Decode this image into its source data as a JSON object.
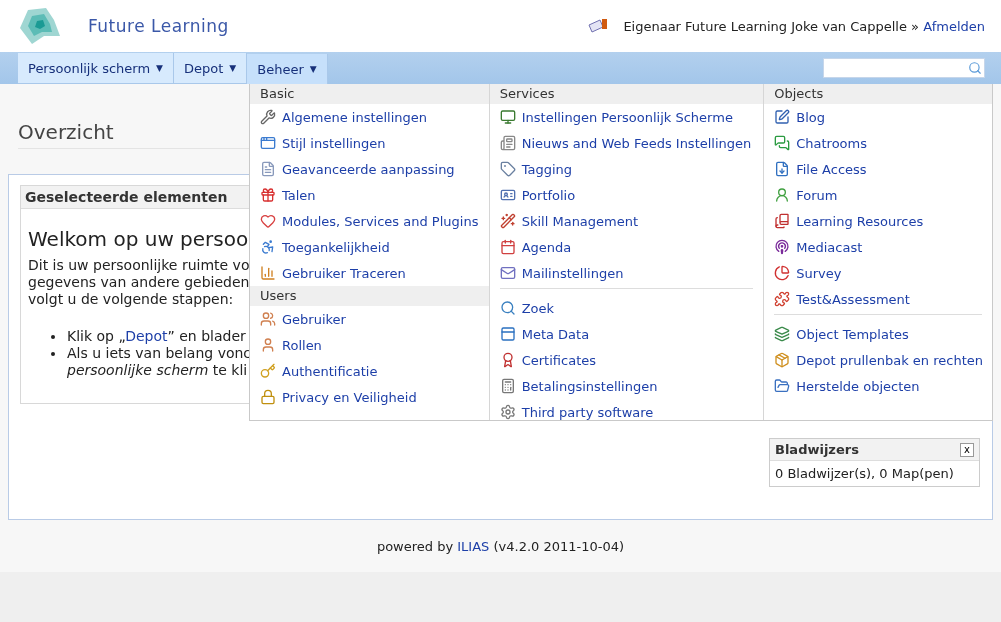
{
  "header": {
    "site_title": "Future Learning",
    "user_text": "Eigenaar Future Learning Joke van Cappelle »",
    "logout_link": "Afmelden"
  },
  "menu": {
    "tabs": [
      {
        "label": "Persoonlijk scherm",
        "selected": false,
        "caret": "▼"
      },
      {
        "label": "Depot",
        "selected": false,
        "caret": "▼"
      },
      {
        "label": "Beheer",
        "selected": true,
        "caret": "▼"
      }
    ],
    "search": {
      "kind": "field"
    }
  },
  "page_title": "Overzicht",
  "selected_items": {
    "title": "Geselecteerde elementen",
    "heading": "Welkom op uw persoo",
    "intro_lines": [
      "Dit is uw persoonlijke ruimte vo",
      "gegevens van andere gebieden",
      "volgt u de volgende stappen:"
    ],
    "bullets": [
      {
        "kind": "link",
        "before": "Klik op „",
        "link": "Depot",
        "after": "” en blader"
      },
      {
        "kind": "text",
        "lines": [
          "Als u iets van belang vonc",
          "*persoonlijke scherm* te kli"
        ]
      }
    ]
  },
  "dropdown": {
    "columns": [
      {
        "groups": [
          {
            "title": "Basic",
            "items": [
              "Algemene instellingen",
              "Stijl instellingen",
              "Geavanceerde aanpassing",
              "Talen",
              "Modules, Services and Plugins",
              "Toegankelijkheid",
              "Gebruiker Traceren"
            ]
          },
          {
            "title": "Users",
            "items": [
              "Gebruiker",
              "Rollen",
              "Authentificatie",
              "Privacy en Veiligheid"
            ]
          }
        ]
      },
      {
        "groups": [
          {
            "title": "Services",
            "items": [
              "Instellingen Persoonlijk Scherme",
              "Nieuws and Web Feeds Instellingen",
              "Tagging",
              "Portfolio",
              "Skill Management",
              "Agenda",
              "Mailinstellingen"
            ]
          },
          {
            "items": [
              "Zoek",
              "Meta Data",
              "Certificates",
              "Betalingsinstellingen",
              "Third party software"
            ]
          }
        ]
      },
      {
        "groups": [
          {
            "title": "Objects",
            "items": [
              "Blog",
              "Chatrooms",
              "File Access",
              "Forum",
              "Learning Resources",
              "Mediacast",
              "Survey",
              "Test&Assessment"
            ]
          },
          {
            "items": [
              "Object Templates",
              "Depot prullenbak en rechten",
              "Herstelde objecten"
            ]
          }
        ]
      }
    ]
  },
  "bookmarks": {
    "title": "Bladwijzers",
    "close": "x",
    "summary": "0 Bladwijzer(s), 0 Map(pen)"
  },
  "footer": {
    "prefix": "powered by",
    "link": "ILIAS",
    "suffix": "(v4.2.0 2011-10-04)"
  }
}
